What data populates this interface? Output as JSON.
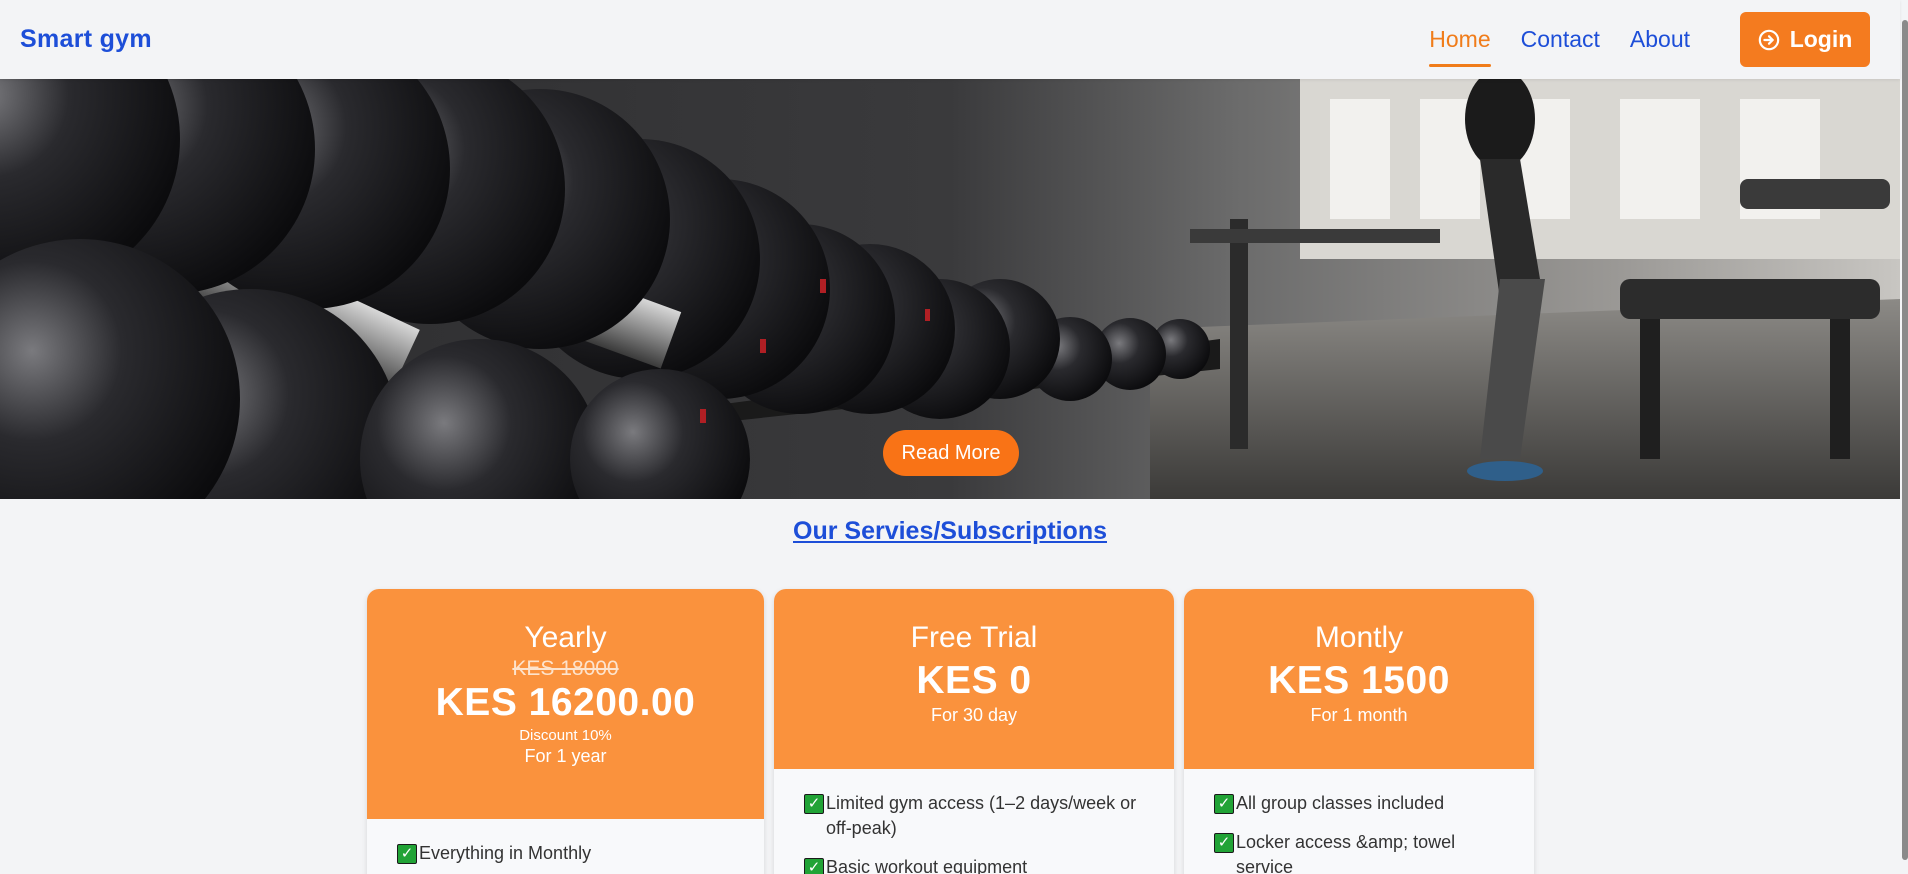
{
  "nav": {
    "brand": "Smart gym",
    "links": [
      "Home",
      "Contact",
      "About"
    ],
    "login_label": "Login"
  },
  "hero": {
    "button_label": "Read More"
  },
  "section_title": "Our Servies/Subscriptions",
  "plans": [
    {
      "title": "Yearly",
      "old_price": "KES 18000",
      "price": "KES 16200.00",
      "discount": "Discount 10%",
      "period": "For 1 year",
      "features": [
        "Everything in Monthly"
      ]
    },
    {
      "title": "Free Trial",
      "price": "KES 0",
      "period": "For 30 day",
      "features": [
        "Limited gym access (1–2 days/week or off-peak)",
        "Basic workout equipment"
      ]
    },
    {
      "title": "Montly",
      "price": "KES 1500",
      "period": "For 1 month",
      "features": [
        "All group classes included",
        "Locker access &amp; towel service"
      ]
    }
  ],
  "colors": {
    "brand_blue": "#1d4ed8",
    "accent_orange": "#f47b1f",
    "card_header": "#fa923d",
    "check_green": "#21a336"
  }
}
